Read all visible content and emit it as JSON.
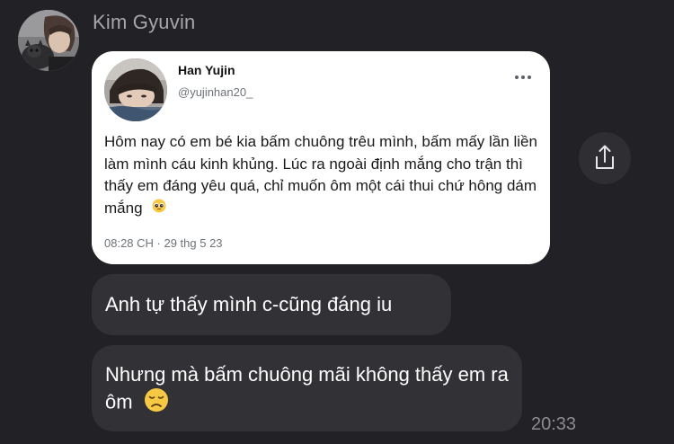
{
  "conversation": {
    "sender_name": "Kim Gyuvin",
    "sent_time": "20:33"
  },
  "shared_tweet": {
    "author_name": "Han Yujin",
    "author_handle": "@yujinhan20_",
    "text": "Hôm nay có em bé kia bấm chuông trêu mình, bấm mấy lần liền làm mình cáu kinh khủng. Lúc ra ngoài định mắng cho trận thì thấy em đáng yêu quá, chỉ muốn ôm một cái thui chứ hông dám mắng",
    "text_emoji": "pleading-face-emoji",
    "timestamp": "08:28 CH · 29 thg 5 23"
  },
  "messages": [
    {
      "text": "Anh tự thấy mình c-cũng đáng iu"
    },
    {
      "text": "Nhưng mà bấm chuông mãi không thấy em ra ôm",
      "emoji": "disappointed-face-emoji"
    }
  ],
  "icons": {
    "more": "more-dots-icon",
    "share": "share-icon"
  },
  "colors": {
    "background": "#222226",
    "bubble": "#323236",
    "card": "#ffffff"
  }
}
